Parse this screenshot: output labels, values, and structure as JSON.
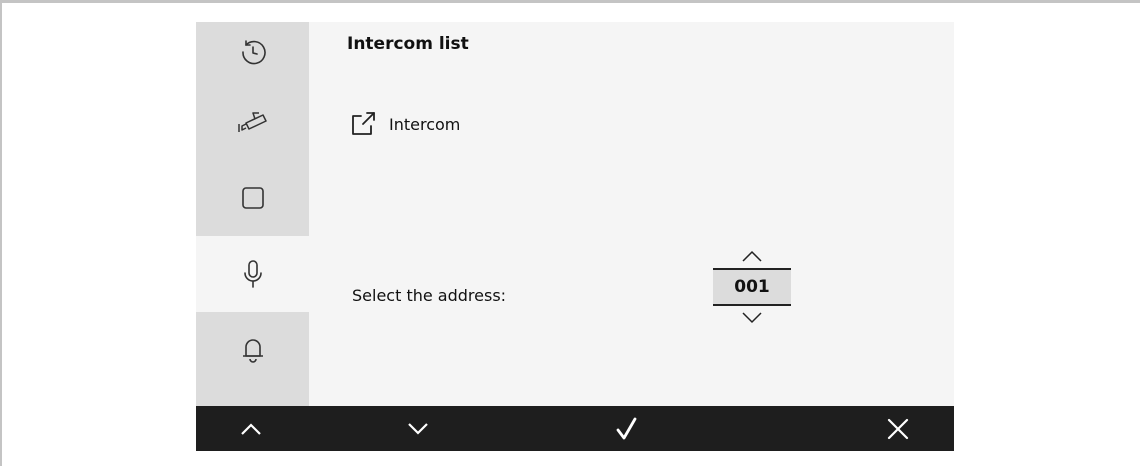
{
  "sidebar": {
    "items": [
      {
        "icon": "history-icon",
        "active": false
      },
      {
        "icon": "surveillance-camera-icon",
        "active": false
      },
      {
        "icon": "square-icon",
        "active": false
      },
      {
        "icon": "microphone-icon",
        "active": true
      },
      {
        "icon": "bell-icon",
        "active": false
      }
    ]
  },
  "main": {
    "title": "Intercom list",
    "link": {
      "icon": "external-link-icon",
      "label": "Intercom"
    },
    "address": {
      "label": "Select the address:",
      "value": "001"
    }
  },
  "bottom_bar": {
    "buttons": [
      {
        "icon": "chevron-up-icon"
      },
      {
        "icon": "chevron-down-icon"
      },
      {
        "icon": "checkmark-icon"
      },
      {
        "icon": "close-icon"
      }
    ]
  },
  "colors": {
    "sidebar_bg": "#dcdcdc",
    "content_bg": "#f5f5f5",
    "bottom_bar_bg": "#1e1e1e"
  }
}
